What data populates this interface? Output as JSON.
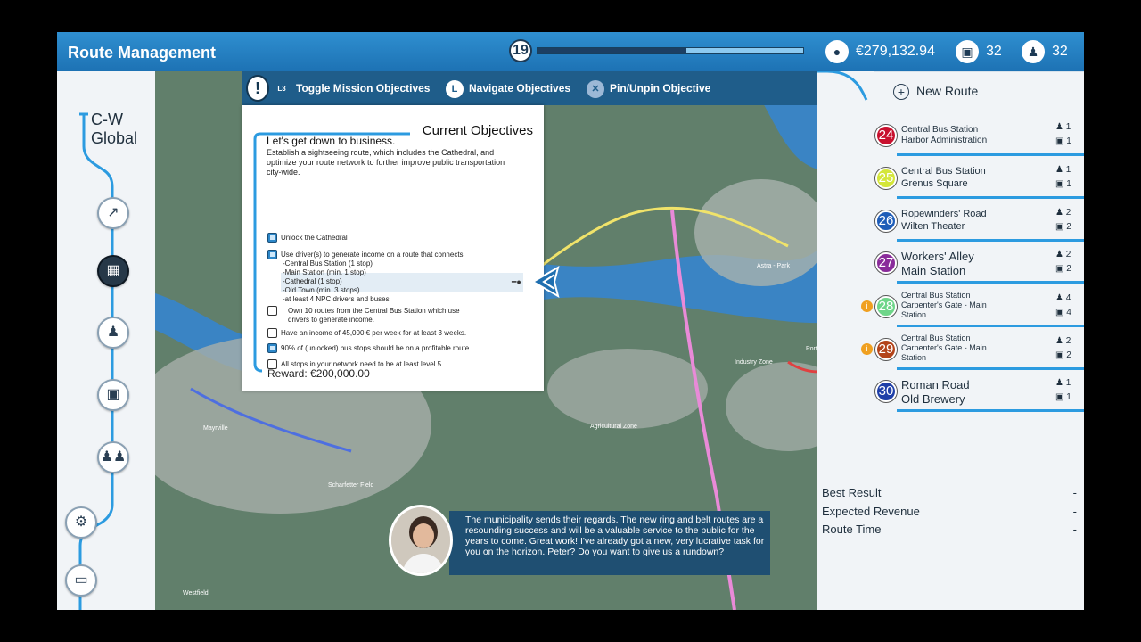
{
  "header": {
    "title": "Route Management",
    "level": "19",
    "progress": 0.56,
    "money": "€279,132.94",
    "buses": "32",
    "drivers": "32",
    "icons": {
      "money": "coins-icon",
      "buses": "bus-icon",
      "drivers": "driver-icon"
    }
  },
  "sidebar": {
    "company": "C-W Global",
    "buttons": [
      {
        "name": "statistics",
        "icon": "chart-icon"
      },
      {
        "name": "map",
        "icon": "map-icon"
      },
      {
        "name": "drivers",
        "icon": "driver-icon"
      },
      {
        "name": "buses",
        "icon": "bus-icon"
      },
      {
        "name": "staff",
        "icon": "people-icon"
      },
      {
        "name": "settings",
        "icon": "gears-icon"
      },
      {
        "name": "computer",
        "icon": "monitor-icon"
      }
    ]
  },
  "toolbar": {
    "toggle": "Toggle Mission Objectives",
    "navigate": "Navigate Objectives",
    "pin": "Pin/Unpin Objective",
    "toggle_key": "L3",
    "navigate_key": "L",
    "pin_key": "✕"
  },
  "objectives": {
    "title": "Current Objectives",
    "heading": "Let's get down to business.",
    "description": "Establish a sightseeing route, which includes the Cathedral, and optimize your route network to further improve public transportation city-wide.",
    "items": [
      {
        "text": "Unlock the Cathedral",
        "checked": true
      },
      {
        "text": "Use driver(s) to generate income on a route that connects:",
        "checked": true,
        "sub": [
          "-Central Bus Station (1 stop)",
          "-Main Station (min. 1 stop)",
          "-Cathedral (1 stop)",
          "-Old Town (min. 3 stops)",
          "-at least 4 NPC drivers and buses"
        ]
      },
      {
        "text": "Own 10 routes from the Central Bus Station which use drivers to generate income.",
        "checked": false
      },
      {
        "text": "Have an income of 45,000 € per week for at least 3 weeks.",
        "checked": false
      },
      {
        "text": "90% of (unlocked) bus stops should be on a profitable route.",
        "checked": true
      },
      {
        "text": "All stops in your network need to be at least level 5.",
        "checked": false
      }
    ],
    "reward": "Reward: €200,000.00"
  },
  "map_labels": {
    "astra_park": "Astra - Park",
    "industry_zone": "Industry Zone",
    "agricultural_zone": "Agricultural Zone",
    "mayrville": "Mayrville",
    "scharfetter_field": "Scharfetter Field",
    "westfield": "Westfield",
    "port": "Port"
  },
  "routes": {
    "new_route": "New Route",
    "list": [
      {
        "num": "24",
        "color": "#c8102e",
        "a": "Central Bus Station",
        "b": "Harbor Administration",
        "drivers": "1",
        "buses": "1",
        "style": "small",
        "warn": false
      },
      {
        "num": "25",
        "color": "#d4e63a",
        "a": "Central Bus Station",
        "b": "Grenus Square",
        "drivers": "1",
        "buses": "1",
        "style": "mid",
        "warn": false
      },
      {
        "num": "26",
        "color": "#1f5db8",
        "a": "Ropewinders' Road",
        "b": "Wilten Theater",
        "drivers": "2",
        "buses": "2",
        "style": "mid",
        "warn": false
      },
      {
        "num": "27",
        "color": "#8a2c9a",
        "a": "Workers' Alley",
        "b": "Main Station",
        "drivers": "2",
        "buses": "2",
        "style": "large",
        "warn": false
      },
      {
        "num": "28",
        "color": "#6fd68a",
        "a": "Central Bus Station",
        "b": "Carpenter's Gate - Main Station",
        "drivers": "4",
        "buses": "4",
        "style": "tiny",
        "warn": true
      },
      {
        "num": "29",
        "color": "#b3441a",
        "a": "Central Bus Station",
        "b": "Carpenter's Gate - Main Station",
        "drivers": "2",
        "buses": "2",
        "style": "tiny",
        "warn": true
      },
      {
        "num": "30",
        "color": "#1f3fa8",
        "a": "Roman Road",
        "b": "Old Brewery",
        "drivers": "1",
        "buses": "1",
        "style": "large",
        "warn": false
      }
    ]
  },
  "stats": {
    "best_result": "Best Result",
    "best_result_value": "-",
    "expected_revenue": "Expected Revenue",
    "expected_revenue_value": "-",
    "route_time": "Route Time",
    "route_time_value": "-"
  },
  "dialogue": {
    "text": "The municipality sends their regards. The new ring and belt routes are a resounding success and will be a valuable service to the public for the years to come. Great work! I've already got a new, very lucrative task for you on the horizon. Peter? Do you want to give us a rundown?"
  }
}
